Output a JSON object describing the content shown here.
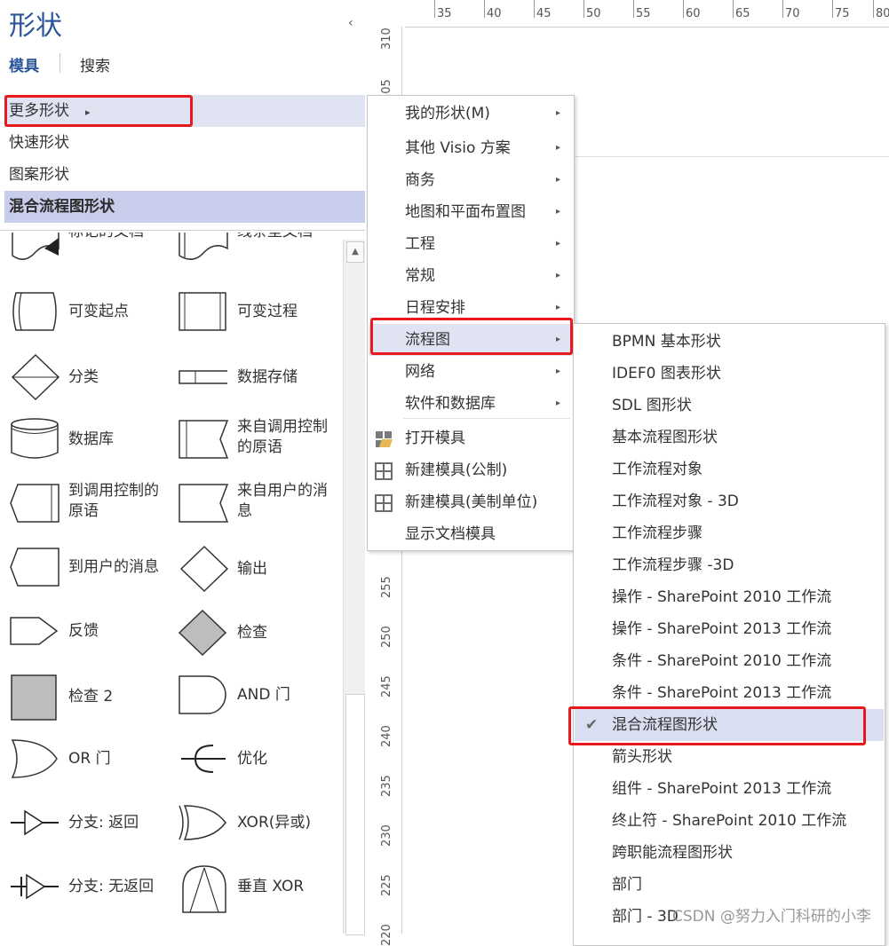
{
  "pane": {
    "title": "形状",
    "tabs": [
      "模具",
      "搜索"
    ],
    "stencils": [
      {
        "label": "更多形状",
        "arrow": "▸"
      },
      {
        "label": "快速形状"
      },
      {
        "label": "图案形状"
      },
      {
        "label": "混合流程图形状"
      }
    ],
    "shapes": [
      {
        "label": "标记的文档",
        "icon": "marked-document-icon"
      },
      {
        "label": "线条型文档",
        "icon": "lined-document-icon"
      },
      {
        "label": "可变起点",
        "icon": "variable-start-icon"
      },
      {
        "label": "可变过程",
        "icon": "variable-process-icon"
      },
      {
        "label": "分类",
        "icon": "sort-icon"
      },
      {
        "label": "数据存储",
        "icon": "data-store-icon"
      },
      {
        "label": "数据库",
        "icon": "database-icon"
      },
      {
        "label": "来自调用控制的原语",
        "icon": "primitive-from-call-icon"
      },
      {
        "label": "到调用控制的原语",
        "icon": "primitive-to-call-icon"
      },
      {
        "label": "来自用户的消息",
        "icon": "message-from-user-icon"
      },
      {
        "label": "到用户的消息",
        "icon": "message-to-user-icon"
      },
      {
        "label": "输出",
        "icon": "output-icon"
      },
      {
        "label": "反馈",
        "icon": "feedback-icon"
      },
      {
        "label": "检查",
        "icon": "check-icon"
      },
      {
        "label": "检查 2",
        "icon": "check-2-icon"
      },
      {
        "label": "AND 门",
        "icon": "and-gate-icon"
      },
      {
        "label": "OR 门",
        "icon": "or-gate-icon"
      },
      {
        "label": "优化",
        "icon": "optimize-icon"
      },
      {
        "label": "分支: 返回",
        "icon": "branch-return-icon"
      },
      {
        "label": "XOR(异或)",
        "icon": "xor-icon"
      },
      {
        "label": "分支: 无返回",
        "icon": "branch-no-return-icon"
      },
      {
        "label": "垂直 XOR",
        "icon": "vertical-xor-icon"
      }
    ]
  },
  "ruler_top": [
    "35",
    "40",
    "45",
    "50",
    "55",
    "60",
    "65",
    "70",
    "75",
    "80"
  ],
  "ruler_left": [
    "310",
    "305",
    "255",
    "250",
    "245",
    "240",
    "235",
    "230",
    "225",
    "220"
  ],
  "menu1": [
    {
      "label": "我的形状(M)",
      "sub": true
    },
    {
      "label": "其他 Visio 方案",
      "sub": true
    },
    {
      "label": "商务",
      "sub": true
    },
    {
      "label": "地图和平面布置图",
      "sub": true
    },
    {
      "label": "工程",
      "sub": true
    },
    {
      "label": "常规",
      "sub": true
    },
    {
      "label": "日程安排",
      "sub": true
    },
    {
      "label": "流程图",
      "sub": true,
      "highlight": true
    },
    {
      "label": "网络",
      "sub": true
    },
    {
      "label": "软件和数据库",
      "sub": true
    },
    {
      "label": "打开模具",
      "icon": "open-folder-icon"
    },
    {
      "label": "新建模具(公制)",
      "icon": "grid-icon"
    },
    {
      "label": "新建模具(美制单位)",
      "icon": "grid-icon"
    },
    {
      "label": "显示文档模具"
    }
  ],
  "menu2": [
    {
      "label": "BPMN 基本形状"
    },
    {
      "label": "IDEF0 图表形状"
    },
    {
      "label": "SDL 图形状"
    },
    {
      "label": "基本流程图形状"
    },
    {
      "label": "工作流程对象"
    },
    {
      "label": "工作流程对象 - 3D"
    },
    {
      "label": "工作流程步骤"
    },
    {
      "label": "工作流程步骤 -3D"
    },
    {
      "label": "操作 - SharePoint 2010 工作流"
    },
    {
      "label": "操作 - SharePoint 2013 工作流"
    },
    {
      "label": "条件 - SharePoint 2010 工作流"
    },
    {
      "label": "条件 - SharePoint 2013 工作流"
    },
    {
      "label": "混合流程图形状",
      "checked": true
    },
    {
      "label": "箭头形状"
    },
    {
      "label": "组件 - SharePoint 2013 工作流"
    },
    {
      "label": "终止符 - SharePoint 2010 工作流"
    },
    {
      "label": "跨职能流程图形状"
    },
    {
      "label": "部门"
    },
    {
      "label": "部门 - 3D"
    }
  ],
  "icons": {
    "submenu": "▸",
    "check": "✔",
    "collapse": "‹",
    "scroll_up": "▲"
  },
  "watermark": "CSDN @努力入门科研的小李"
}
